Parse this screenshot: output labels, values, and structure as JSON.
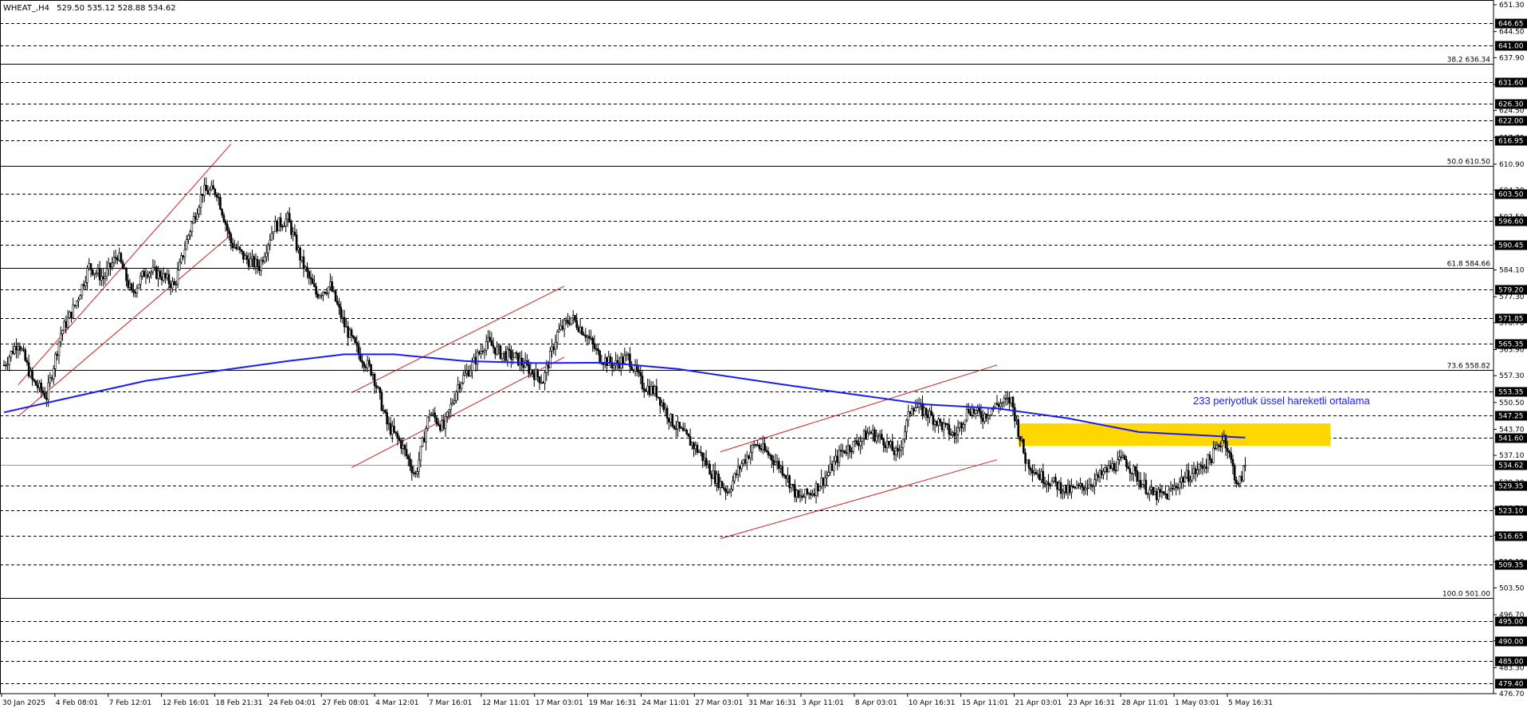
{
  "header": {
    "symbol": "WHEAT_,H4",
    "ohlc": "529.50 535.12 528.88 534.62"
  },
  "annotation": "233 periyotluk üssel hareketli ortalama",
  "colors": {
    "candle": "#000000",
    "ema": "#1a1aff",
    "channel": "#d42020",
    "zone": "#ffd700",
    "grid": "#000000",
    "fib": "#000000"
  },
  "chart_data": {
    "type": "candlestick",
    "title": "WHEAT_,H4",
    "ylim": [
      476.7,
      651.3
    ],
    "y_ticks": [
      "651.30",
      "644.50",
      "637.90",
      "631.10",
      "624.50",
      "617.70",
      "610.90",
      "604.30",
      "597.50",
      "590.70",
      "584.10",
      "577.30",
      "570.70",
      "563.90",
      "557.30",
      "550.50",
      "543.70",
      "537.10",
      "530.30",
      "523.70",
      "516.90",
      "510.10",
      "503.50",
      "496.70",
      "490.10",
      "483.30",
      "476.70"
    ],
    "level_labels": [
      "646.65",
      "641.00",
      "631.60",
      "626.30",
      "622.00",
      "616.95",
      "603.50",
      "596.60",
      "590.45",
      "579.20",
      "571.85",
      "565.35",
      "553.35",
      "547.25",
      "541.60",
      "534.62",
      "529.35",
      "523.10",
      "516.65",
      "509.35",
      "495.00",
      "490.00",
      "485.00",
      "479.40"
    ],
    "fib_levels": [
      {
        "label": "38.2 636.34",
        "value": 636.34
      },
      {
        "label": "50.0 610.50",
        "value": 610.5
      },
      {
        "label": "61.8 584.66",
        "value": 584.66
      },
      {
        "label": "73.6 558.82",
        "value": 558.82
      },
      {
        "label": "100.0 501.00",
        "value": 501.0
      }
    ],
    "current_price": "534.62",
    "x_labels": [
      "30 Jan 2025",
      "4 Feb 08:01",
      "7 Feb 12:01",
      "12 Feb 16:01",
      "18 Feb 21:31",
      "24 Feb 04:01",
      "27 Feb 08:01",
      "4 Mar 12:01",
      "7 Mar 16:01",
      "12 Mar 11:01",
      "17 Mar 03:01",
      "19 Mar 16:31",
      "24 Mar 11:01",
      "27 Mar 03:01",
      "31 Mar 16:31",
      "3 Apr 11:01",
      "8 Apr 03:01",
      "10 Apr 16:31",
      "15 Apr 11:01",
      "21 Apr 03:01",
      "23 Apr 16:31",
      "28 Apr 11:01",
      "1 May 03:01",
      "5 May 16:31"
    ],
    "price_path": [
      [
        0,
        560
      ],
      [
        2,
        566
      ],
      [
        4,
        556
      ],
      [
        6,
        552
      ],
      [
        8,
        568
      ],
      [
        10,
        575
      ],
      [
        12,
        585
      ],
      [
        14,
        582
      ],
      [
        16,
        588
      ],
      [
        18,
        578
      ],
      [
        20,
        584
      ],
      [
        22,
        583
      ],
      [
        24,
        580
      ],
      [
        26,
        593
      ],
      [
        28,
        604
      ],
      [
        30,
        604
      ],
      [
        32,
        591
      ],
      [
        34,
        587
      ],
      [
        36,
        585
      ],
      [
        38,
        595
      ],
      [
        40,
        597
      ],
      [
        42,
        586
      ],
      [
        44,
        578
      ],
      [
        46,
        580
      ],
      [
        48,
        570
      ],
      [
        50,
        563
      ],
      [
        52,
        558
      ],
      [
        54,
        545
      ],
      [
        56,
        540
      ],
      [
        58,
        532
      ],
      [
        60,
        548
      ],
      [
        62,
        544
      ],
      [
        64,
        555
      ],
      [
        66,
        560
      ],
      [
        68,
        566
      ],
      [
        70,
        563
      ],
      [
        72,
        562
      ],
      [
        74,
        559
      ],
      [
        76,
        556
      ],
      [
        78,
        568
      ],
      [
        80,
        572
      ],
      [
        82,
        568
      ],
      [
        84,
        562
      ],
      [
        86,
        560
      ],
      [
        88,
        562
      ],
      [
        90,
        555
      ],
      [
        92,
        553
      ],
      [
        94,
        546
      ],
      [
        96,
        542
      ],
      [
        98,
        538
      ],
      [
        100,
        532
      ],
      [
        102,
        528
      ],
      [
        104,
        535
      ],
      [
        106,
        540
      ],
      [
        108,
        537
      ],
      [
        110,
        533
      ],
      [
        112,
        526
      ],
      [
        114,
        528
      ],
      [
        116,
        532
      ],
      [
        118,
        538
      ],
      [
        120,
        540
      ],
      [
        122,
        543
      ],
      [
        124,
        541
      ],
      [
        126,
        537
      ],
      [
        128,
        550
      ],
      [
        130,
        548
      ],
      [
        132,
        545
      ],
      [
        134,
        542
      ],
      [
        136,
        549
      ],
      [
        138,
        547
      ],
      [
        140,
        550
      ],
      [
        142,
        551
      ],
      [
        144,
        536
      ],
      [
        146,
        532
      ],
      [
        148,
        530
      ],
      [
        150,
        528
      ],
      [
        152,
        529
      ],
      [
        154,
        531
      ],
      [
        156,
        534
      ],
      [
        158,
        536
      ],
      [
        160,
        531
      ],
      [
        162,
        527
      ],
      [
        164,
        527
      ],
      [
        166,
        531
      ],
      [
        168,
        533
      ],
      [
        170,
        536
      ],
      [
        172,
        542
      ],
      [
        174,
        529
      ],
      [
        175,
        534.62
      ]
    ],
    "ema_path": [
      [
        0,
        548
      ],
      [
        20,
        556
      ],
      [
        40,
        561
      ],
      [
        48,
        562.7
      ],
      [
        55,
        562.7
      ],
      [
        65,
        561
      ],
      [
        75,
        560.5
      ],
      [
        85,
        560.6
      ],
      [
        95,
        559
      ],
      [
        110,
        555
      ],
      [
        130,
        550
      ],
      [
        140,
        549
      ],
      [
        150,
        546.5
      ],
      [
        160,
        543
      ],
      [
        175,
        541.6
      ]
    ],
    "channels": [
      {
        "from": [
          2,
          555
        ],
        "to": [
          32,
          616
        ]
      },
      {
        "from": [
          2,
          547
        ],
        "to": [
          32,
          593
        ]
      },
      {
        "from": [
          49,
          553
        ],
        "to": [
          79,
          580
        ]
      },
      {
        "from": [
          49,
          534
        ],
        "to": [
          79,
          562
        ]
      },
      {
        "from": [
          101,
          538
        ],
        "to": [
          140,
          560
        ]
      },
      {
        "from": [
          101,
          516
        ],
        "to": [
          140,
          536
        ]
      }
    ],
    "zone": {
      "x_from": 143,
      "x_to": 187,
      "y_low": 539.5,
      "y_high": 545.2
    }
  }
}
